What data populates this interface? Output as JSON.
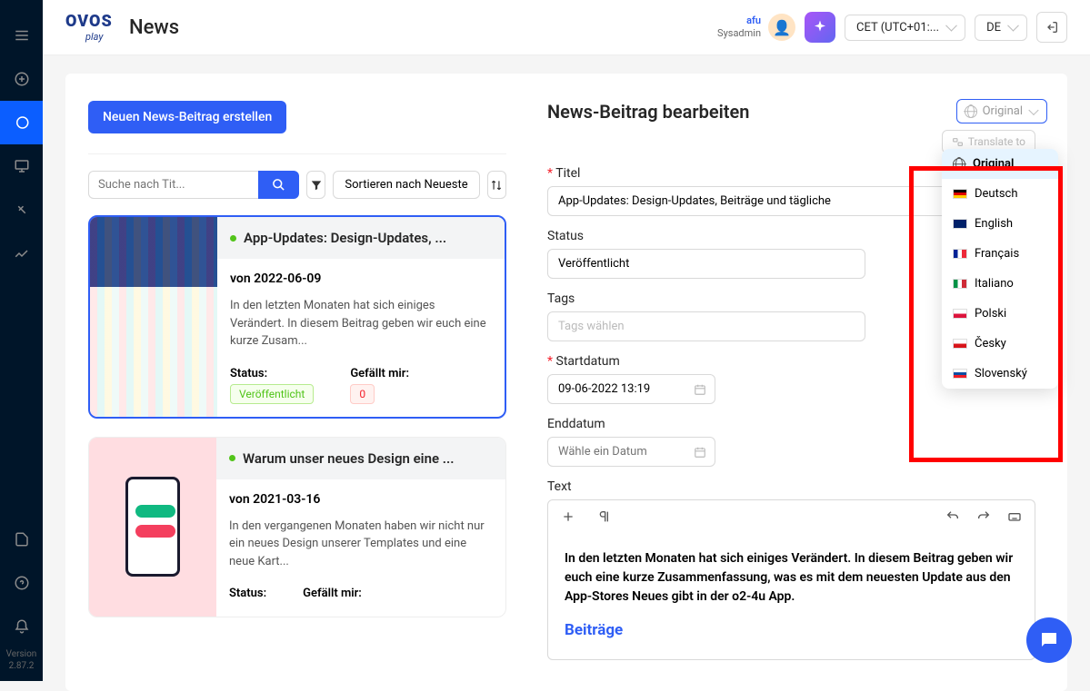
{
  "logo": {
    "line1": "OVOS",
    "line2": "play"
  },
  "page_title": "News",
  "user": {
    "name": "afu",
    "role": "Sysadmin"
  },
  "timezone": "CET (UTC+01:...",
  "locale": "DE",
  "left": {
    "create_btn": "Neuen News-Beitrag erstellen",
    "search_placeholder": "Suche nach Tit...",
    "sort_label": "Sortieren nach Neueste"
  },
  "cards": [
    {
      "title": "App-Updates: Design-Updates, ...",
      "date_prefix": "von ",
      "date": "2022-06-09",
      "excerpt": "In den letzten Monaten hat sich einiges Verändert. In diesem Beitrag geben wir euch eine kurze Zusam...",
      "status_label": "Status:",
      "status_value": "Veröffentlicht",
      "likes_label": "Gefällt mir:",
      "likes_value": "0"
    },
    {
      "title": "Warum unser neues Design eine ...",
      "date_prefix": "von ",
      "date": "2021-03-16",
      "excerpt": "In den vergangenen Monaten haben wir nicht nur ein neues Design unserer Templates und eine neue Kart...",
      "status_label": "Status:",
      "likes_label": "Gefällt mir:"
    }
  ],
  "right": {
    "title": "News-Beitrag bearbeiten",
    "lang_current": "Original",
    "translate_btn": "Translate to",
    "labels": {
      "title": "Titel",
      "status": "Status",
      "tags": "Tags",
      "start": "Startdatum",
      "end": "Enddatum",
      "text": "Text"
    },
    "values": {
      "title": "App-Updates: Design-Updates, Beiträge und tägliche",
      "status": "Veröffentlicht",
      "tags_placeholder": "Tags wählen",
      "start": "09-06-2022 13:19",
      "end_placeholder": "Wähle ein Datum"
    },
    "editor": {
      "paragraph": "In den letzten Monaten hat sich einiges Verändert. In diesem Beitrag geben wir euch eine kurze Zusammenfassung, was es mit dem neuesten Update aus den App-Stores Neues gibt in der o2-4u App.",
      "heading": "Beiträge"
    }
  },
  "dropdown": [
    {
      "label": "Original",
      "flag": "globe",
      "active": true
    },
    {
      "label": "Deutsch",
      "flag": "de"
    },
    {
      "label": "English",
      "flag": "en"
    },
    {
      "label": "Français",
      "flag": "fr"
    },
    {
      "label": "Italiano",
      "flag": "it"
    },
    {
      "label": "Polski",
      "flag": "pl"
    },
    {
      "label": "Česky",
      "flag": "cz"
    },
    {
      "label": "Slovenský",
      "flag": "sk"
    }
  ],
  "footer": {
    "line1": "Version",
    "line2": "2.87.2"
  }
}
